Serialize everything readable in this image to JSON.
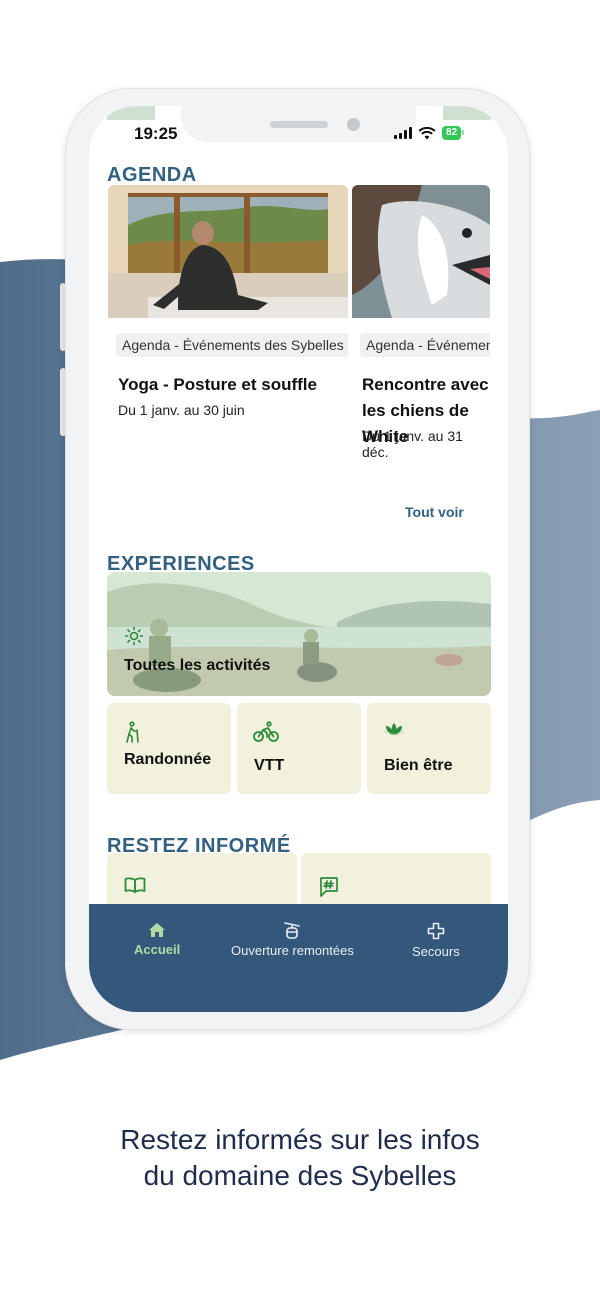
{
  "status_bar": {
    "time": "19:25",
    "battery": "82"
  },
  "agenda": {
    "title": "AGENDA",
    "see_all": "Tout voir",
    "cards": [
      {
        "tag": "Agenda - Événements des Sybelles",
        "title": "Yoga - Posture et souffle",
        "date": "Du 1 janv. au 30 juin"
      },
      {
        "tag": "Agenda - Événements des Sybelles",
        "title": "Rencontre avec les chiens de White",
        "date": "Du 1 janv. au 31 déc."
      }
    ]
  },
  "experiences": {
    "title": "EXPERIENCES",
    "hero_label": "Toutes les activités",
    "tiles": [
      {
        "label": "Randonnée",
        "icon": "hiking-icon"
      },
      {
        "label": "VTT",
        "icon": "bike-icon"
      },
      {
        "label": "Bien être",
        "icon": "lotus-icon"
      }
    ]
  },
  "informed": {
    "title": "RESTEZ INFORMÉ",
    "cards": [
      {
        "icon": "book-icon"
      },
      {
        "icon": "hashtag-icon"
      }
    ]
  },
  "tab_bar": {
    "tabs": [
      {
        "label": "Accueil",
        "icon": "home-icon",
        "active": true
      },
      {
        "label": "Ouverture remontées",
        "icon": "gondola-icon",
        "active": false
      },
      {
        "label": "Secours",
        "icon": "cross-icon",
        "active": false
      }
    ]
  },
  "caption": {
    "line1": "Restez informés sur les infos",
    "line2": "du domaine des Sybelles"
  },
  "colors": {
    "brand_blue": "#33607f",
    "tab_bar": "#33587b",
    "active_tab": "#b3d9a4",
    "accent_green": "#2e8b3a",
    "tile_bg": "#f2f1de"
  }
}
